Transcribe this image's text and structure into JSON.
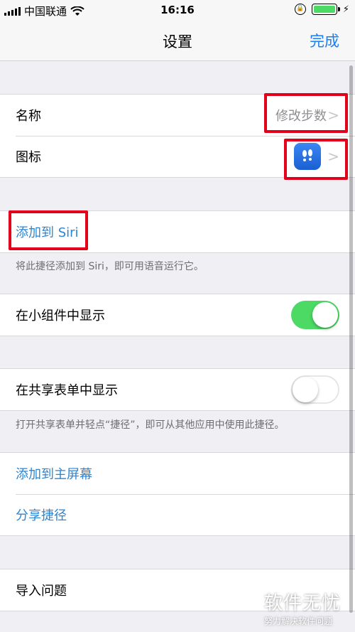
{
  "status_bar": {
    "carrier": "中国联通",
    "time": "16:16"
  },
  "nav": {
    "title": "设置",
    "done": "完成"
  },
  "section1": {
    "name_label": "名称",
    "name_value": "修改步数",
    "icon_label": "图标"
  },
  "siri": {
    "add_label": "添加到 Siri",
    "footer": "将此捷径添加到 Siri，即可用语音运行它。"
  },
  "widget": {
    "label": "在小组件中显示",
    "enabled": true
  },
  "share_sheet": {
    "label": "在共享表单中显示",
    "enabled": false,
    "footer": "打开共享表单并轻点“捷径”，即可从其他应用中使用此捷径。"
  },
  "actions": {
    "home_screen": "添加到主屏幕",
    "share": "分享捷径"
  },
  "import": {
    "label": "导入问题"
  },
  "watermark": {
    "main": "软件无忧",
    "sub": "努力解决软件问题"
  },
  "colors": {
    "accent": "#1a7ff5",
    "toggle_on": "#4cd964",
    "annotation": "#e3001b"
  }
}
